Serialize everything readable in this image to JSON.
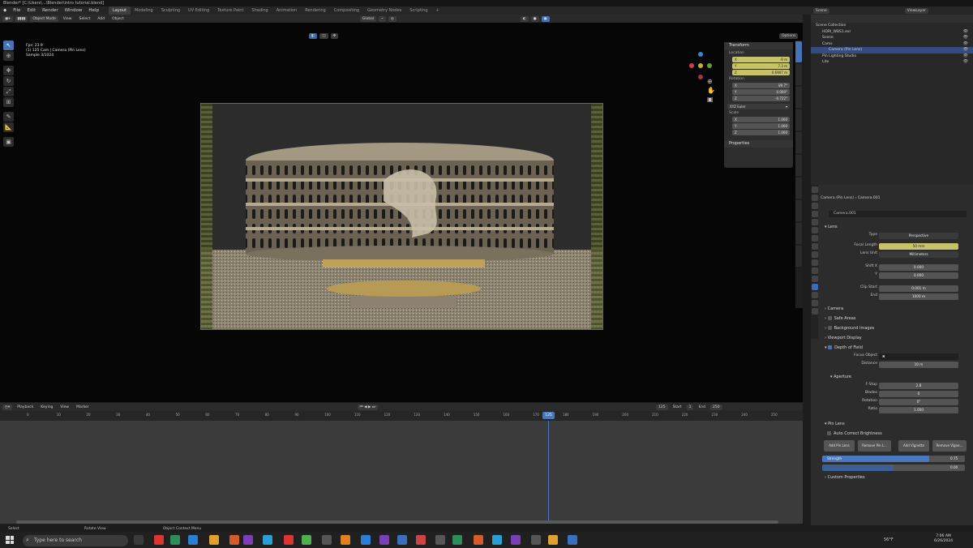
{
  "title": "Blender* [C:\\Users\\...\\Blender\\intro tutorial.blend]",
  "menu": [
    "File",
    "Edit",
    "Render",
    "Window",
    "Help"
  ],
  "workspaces": [
    "Layout",
    "Modeling",
    "Sculpting",
    "UV Editing",
    "Texture Paint",
    "Shading",
    "Animation",
    "Rendering",
    "Compositing",
    "Geometry Nodes",
    "Scripting",
    "+"
  ],
  "scene": {
    "label": "Scene",
    "view_layer": "ViewLayer"
  },
  "viewport": {
    "mode": "Object Mode",
    "menus": [
      "View",
      "Select",
      "Add",
      "Object"
    ],
    "transform_orientation": "Global",
    "options": "Options",
    "info": [
      "Fps: 23.9",
      "(1) 125 Cam | Camera (Pin Lens)",
      "Sample 3/1024"
    ]
  },
  "transform": {
    "title": "Transform",
    "location_label": "Location",
    "location": [
      {
        "axis": "X",
        "value": "-9 m"
      },
      {
        "axis": "Y",
        "value": "7.3 m"
      },
      {
        "axis": "Z",
        "value": "0.6907 m"
      }
    ],
    "rotation_label": "Rotation",
    "rotation": [
      {
        "axis": "X",
        "value": "89.7°"
      },
      {
        "axis": "Y",
        "value": "0.000°"
      },
      {
        "axis": "Z",
        "value": "-0.722°"
      }
    ],
    "rotation_mode": "XYZ Euler",
    "scale_label": "Scale",
    "scale": [
      {
        "axis": "X",
        "value": "1.000"
      },
      {
        "axis": "Y",
        "value": "1.000"
      },
      {
        "axis": "Z",
        "value": "1.000"
      }
    ],
    "properties_title": "Properties"
  },
  "timeline": {
    "menus": [
      "Playback",
      "Keying",
      "View",
      "Marker"
    ],
    "current_frame": "125",
    "start_label": "Start",
    "start": "1",
    "end_label": "End",
    "end": "250",
    "ticks": [
      "0",
      "10",
      "20",
      "30",
      "40",
      "50",
      "60",
      "70",
      "80",
      "90",
      "100",
      "110",
      "120",
      "130",
      "140",
      "150",
      "160",
      "170",
      "180",
      "190",
      "200",
      "210",
      "220",
      "230",
      "240",
      "250"
    ]
  },
  "status": [
    "Select",
    "Rotate View",
    "Object Context Menu"
  ],
  "outliner": {
    "title": "Scene Collection",
    "items": [
      {
        "name": "HDRI_WBS1.exr",
        "indent": 1
      },
      {
        "name": "Scene",
        "indent": 1
      },
      {
        "name": "Cams",
        "indent": 1
      },
      {
        "name": "Camera (Pin Lens)",
        "indent": 2,
        "selected": true
      },
      {
        "name": "Pin Lighting Studio",
        "indent": 1
      },
      {
        "name": "Lite",
        "indent": 1
      }
    ]
  },
  "properties": {
    "breadcrumb": [
      "Camera (Pin Lens)",
      "Camera.001"
    ],
    "datablock": "Camera.001",
    "lens_section": "Lens",
    "type_label": "Type",
    "type": "Perspective",
    "focal_label": "Focal Length",
    "focal": "50 mm",
    "lens_unit_label": "Lens Unit",
    "lens_unit": "Millimeters",
    "shift_x_label": "Shift X",
    "shift_x": "0.000",
    "shift_y_label": "Y",
    "shift_y": "0.000",
    "clip_start_label": "Clip Start",
    "clip_start": "0.001 m",
    "clip_end_label": "End",
    "clip_end": "1000 m",
    "sections": [
      "Camera",
      "Safe Areas",
      "Background Images",
      "Viewport Display"
    ],
    "dof_section": "Depth of Field",
    "focus_object_label": "Focus Object",
    "distance_label": "Distance",
    "distance": "10 m",
    "aperture_section": "Aperture",
    "fstop_label": "F-Stop",
    "fstop": "2.8",
    "blades_label": "Blades",
    "blades": "0",
    "rotation_label": "Rotation",
    "rotation": "0°",
    "ratio_label": "Ratio",
    "ratio": "1.000",
    "pin_section": "Pin Lens",
    "auto_label": "Auto Correct Brightness",
    "buttons": [
      "Add Pin Lens",
      "Remove Pin L...",
      "Add Vignette",
      "Remove Vigne..."
    ],
    "slider1_label": "Strength",
    "slider1": "0.75",
    "slider2": "0.00",
    "custom": "Custom Properties"
  },
  "taskbar": {
    "search_placeholder": "Type here to search",
    "weather": "56°F",
    "time": "7:06 AM",
    "date": "6/26/2024"
  }
}
